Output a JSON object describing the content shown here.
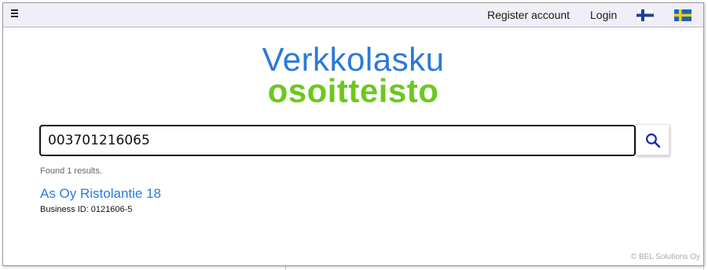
{
  "nav": {
    "menu_icon": "hamburger-menu-icon",
    "register_label": "Register account",
    "login_label": "Login",
    "flags": [
      {
        "name": "finnish-flag-icon",
        "colors": {
          "field": "#ffffff",
          "cross": "#1d3f9c"
        }
      },
      {
        "name": "swedish-flag-icon",
        "colors": {
          "field": "#1a64b4",
          "cross": "#f7cc1a"
        }
      }
    ]
  },
  "logo": {
    "line1": "Verkkolasku",
    "line2": "osoitteisto",
    "colors": {
      "line1": "#2a7ad8",
      "line2": "#6cc81e"
    }
  },
  "search": {
    "value": "003701216065",
    "button_icon": "search-icon"
  },
  "results": {
    "summary": "Found 1 results.",
    "items": [
      {
        "name": "As Oy Ristolantie 18",
        "business_id": "Business ID: 0121606-5"
      }
    ]
  },
  "footer": {
    "copyright": "© BEL Solutions Oy"
  },
  "colors": {
    "accent": "#2a7ad8",
    "brand_green": "#6cc81e",
    "topbar_bg": "#f0eef6"
  }
}
